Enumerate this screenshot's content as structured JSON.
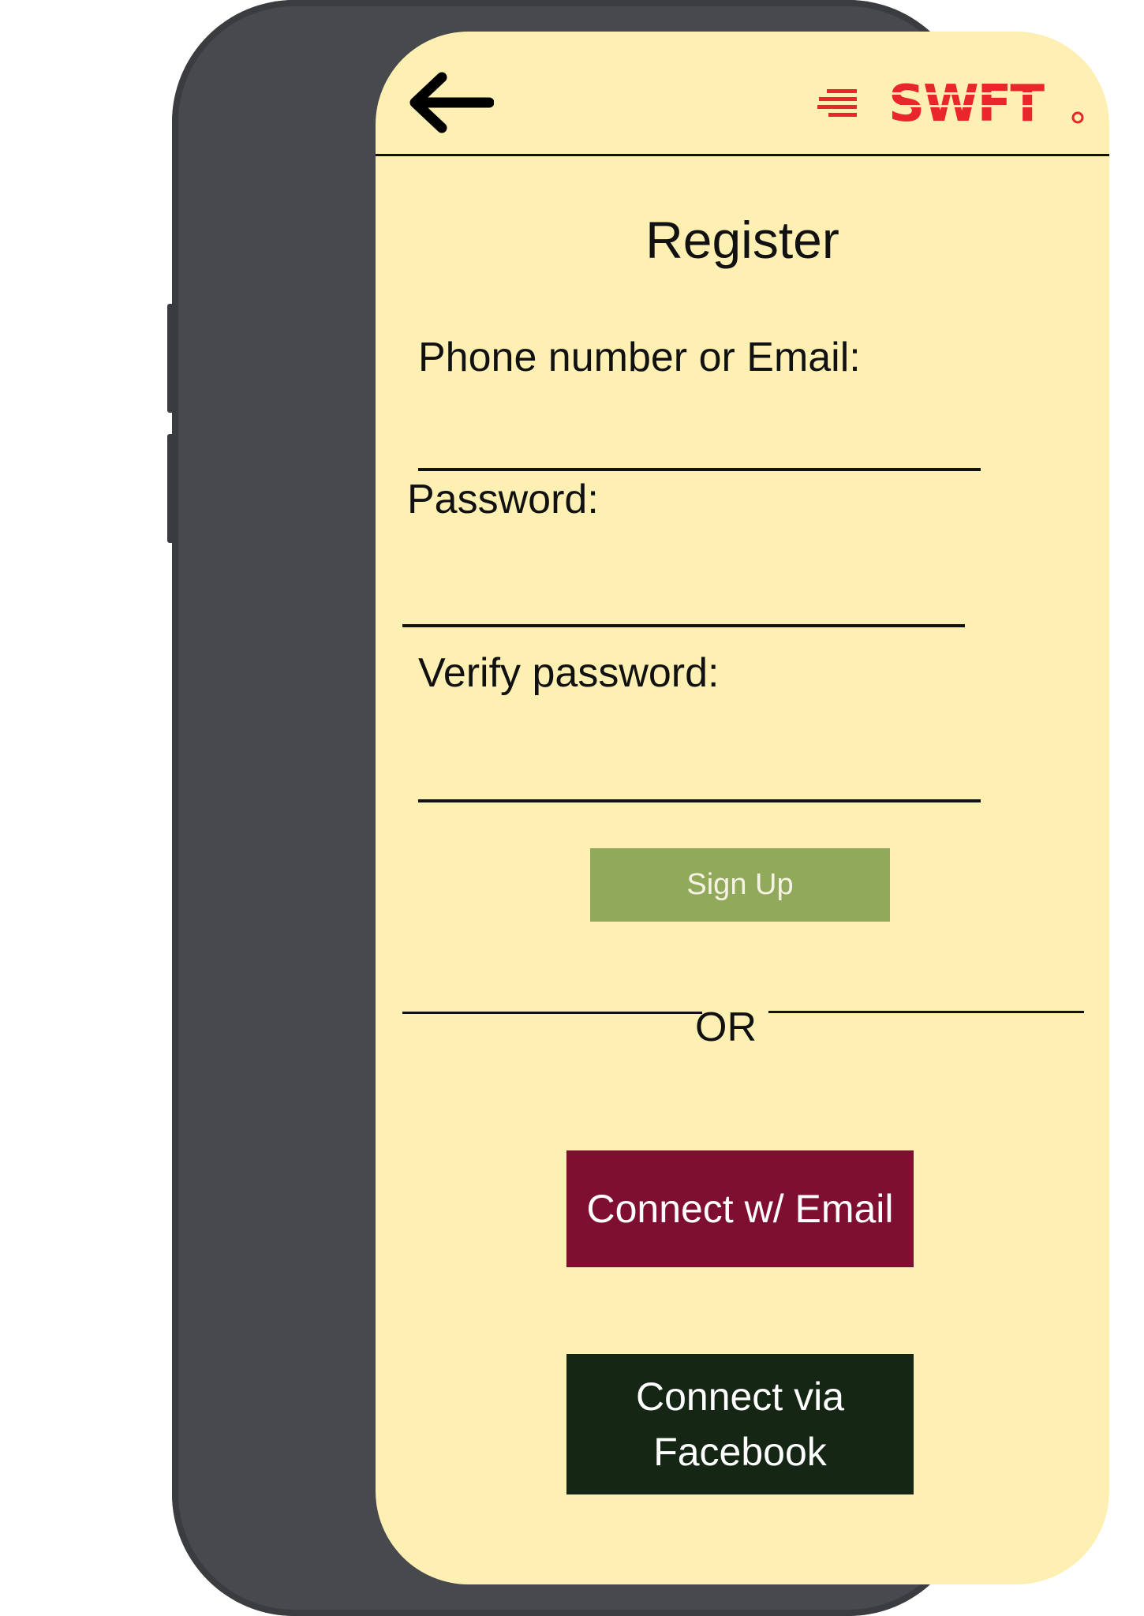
{
  "header": {
    "back_icon": "arrow-left-icon",
    "logo_text": "SWFT",
    "logo_color": "#e8262b"
  },
  "form": {
    "title": "Register",
    "phone_email_label": "Phone number or Email:",
    "phone_email_value": "",
    "password_label": "Password:",
    "password_value": "",
    "verify_label": "Verify password:",
    "verify_value": ""
  },
  "actions": {
    "signup_label": "Sign Up",
    "divider_text": "OR",
    "email_label": "Connect w/ Email",
    "facebook_label_line1": "Connect via",
    "facebook_label_line2": "Facebook"
  },
  "colors": {
    "screen_bg": "#fdf0b2",
    "signup_bg": "#91a95a",
    "email_bg": "#7f0f31",
    "facebook_bg": "#152714",
    "device_frame": "#48494d"
  }
}
